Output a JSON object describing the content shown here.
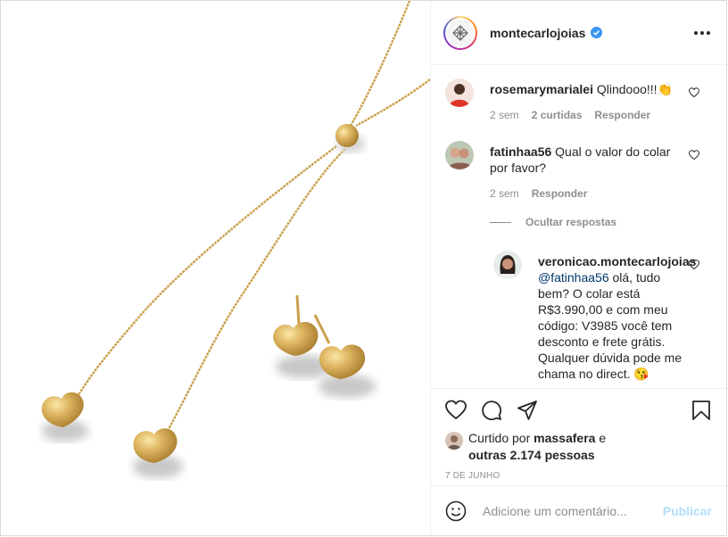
{
  "post": {
    "account": "montecarlojoias",
    "photo": {
      "alt": "Colar e brincos de coração dourados",
      "colors": {
        "gold": "#d8b15c",
        "gold_dark": "#b48c3c",
        "shadow": "#c9c9c9"
      }
    }
  },
  "comments": [
    {
      "user": "rosemarymarialei",
      "text": "Qlindooo!!!👏",
      "time": "2 sem",
      "likes": "2 curtidas",
      "reply": "Responder"
    },
    {
      "user": "fatinhaa56",
      "text": "Qual o valor do colar por favor?",
      "time": "2 sem",
      "reply": "Responder",
      "hide_replies": "Ocultar respostas",
      "replies": [
        {
          "user": "veronicao.montecarlojoias",
          "mention": "@fatinhaa56",
          "text": "olá, tudo bem? O colar está R$3.990,00 e com meu código: V3985 você tem desconto e frete grátis. Qualquer dúvida pode me chama no direct. 😘"
        }
      ]
    }
  ],
  "likes": {
    "prefix": "Curtido por",
    "user": "massafera",
    "connector": "e",
    "others": "outras 2.174 pessoas"
  },
  "date": "7 DE JUNHO",
  "add_comment": {
    "placeholder": "Adicione um comentário...",
    "publish": "Publicar"
  },
  "colors": {
    "link": "#00376b",
    "muted": "#8e8e8e",
    "publish_disabled": "#b2dffc",
    "verified": "#3897f0"
  },
  "icons": [
    "verified-badge-icon",
    "more-options-icon",
    "heart-icon",
    "comment-icon",
    "share-icon",
    "bookmark-icon",
    "emoji-icon"
  ]
}
